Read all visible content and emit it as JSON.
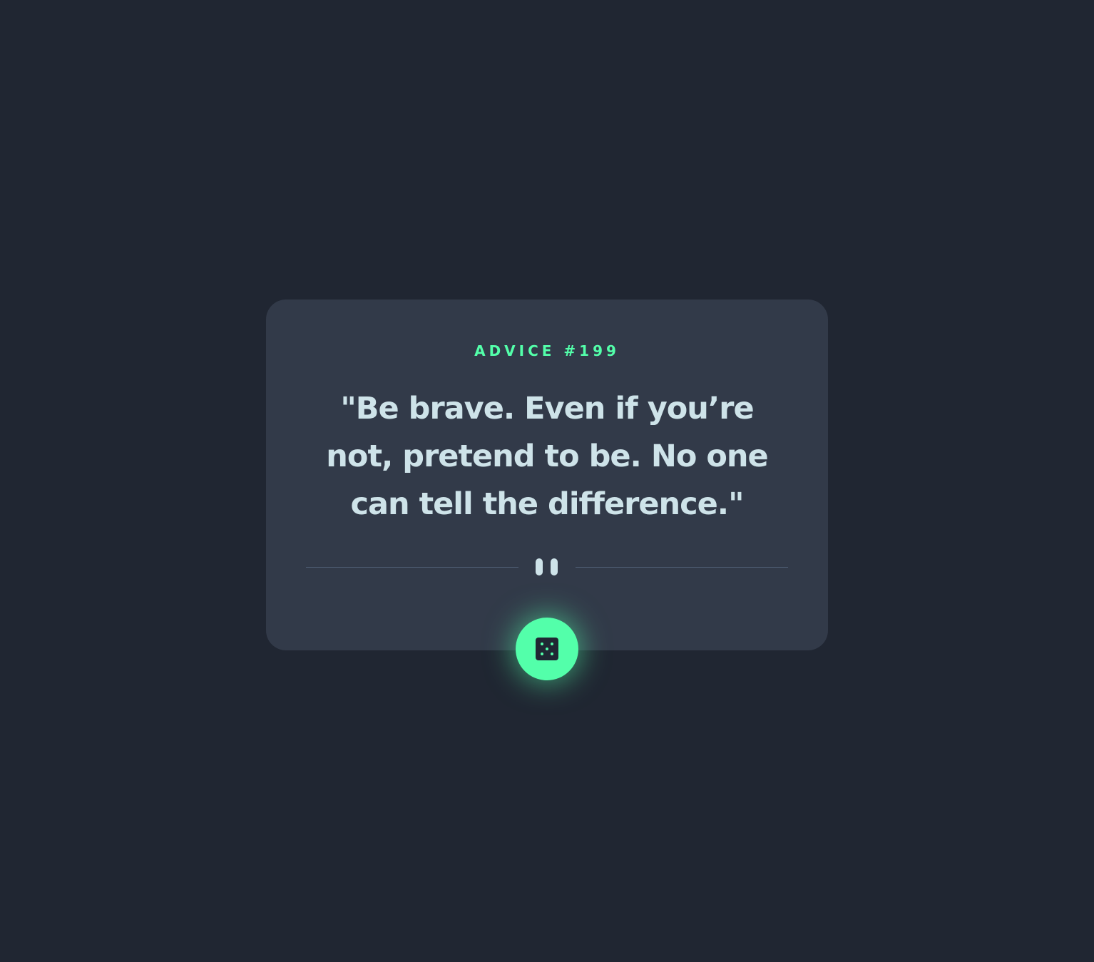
{
  "advice": {
    "id_label": "ADVICE #199",
    "text": "\"Be brave. Even if you’re not, pretend to be. No one can tell the difference.\""
  },
  "icons": {
    "divider": "pause-icon",
    "button": "dice-icon"
  },
  "colors": {
    "background": "#202632",
    "card": "#323A49",
    "accent": "#53FFAA",
    "text": "#CEE3E9",
    "divider": "#4F5D74"
  }
}
